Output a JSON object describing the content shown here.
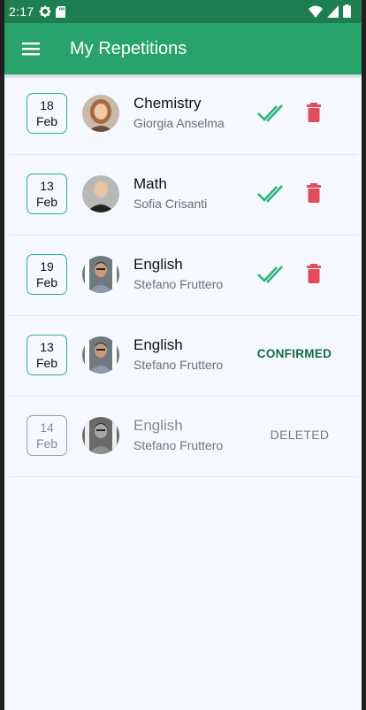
{
  "status_bar": {
    "time": "2:17"
  },
  "app_bar": {
    "title": "My Repetitions"
  },
  "colors": {
    "primary": "#28a36a",
    "status": "#1f7e50",
    "confirm": "#2db47a",
    "delete": "#e04c5e"
  },
  "repetitions": [
    {
      "day": "18",
      "month": "Feb",
      "subject": "Chemistry",
      "teacher": "Giorgia Anselma",
      "state": "pending"
    },
    {
      "day": "13",
      "month": "Feb",
      "subject": "Math",
      "teacher": "Sofia Crisanti",
      "state": "pending"
    },
    {
      "day": "19",
      "month": "Feb",
      "subject": "English",
      "teacher": "Stefano Fruttero",
      "state": "pending"
    },
    {
      "day": "13",
      "month": "Feb",
      "subject": "English",
      "teacher": "Stefano Fruttero",
      "state": "confirmed",
      "state_label": "CONFIRMED"
    },
    {
      "day": "14",
      "month": "Feb",
      "subject": "English",
      "teacher": "Stefano Fruttero",
      "state": "deleted",
      "state_label": "DELETED"
    }
  ]
}
